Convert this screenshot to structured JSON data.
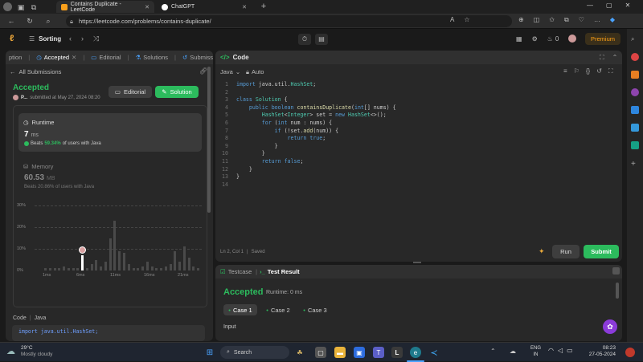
{
  "browser": {
    "tabs": [
      {
        "title": "Contains Duplicate - LeetCode",
        "active": true
      },
      {
        "title": "ChatGPT",
        "active": false
      }
    ],
    "new_tab": "+",
    "url": "https://leetcode.com/problems/contains-duplicate/"
  },
  "lc": {
    "problem_list": "Sorting",
    "premium": "Premium",
    "streak": "0"
  },
  "left": {
    "tabs": [
      "ption",
      "Accepted",
      "Editorial",
      "Solutions",
      "Submissions"
    ],
    "all_submissions": "All Submissions",
    "status": "Accepted",
    "user": "P...",
    "submitted": "submitted at May 27, 2024 08:20",
    "editorial_btn": "Editorial",
    "solution_btn": "Solution",
    "runtime_label": "Runtime",
    "runtime_value": "7",
    "runtime_unit": "ms",
    "beats_prefix": "Beats",
    "runtime_beats": "59.34%",
    "beats_suffix": "of users with Java",
    "memory_label": "Memory",
    "memory_value": "60.53",
    "memory_unit": "MB",
    "memory_beats": "Beats 20.86% of users with Java",
    "y_ticks": [
      "30%",
      "20%",
      "10%",
      "0%"
    ],
    "x_ticks": [
      "1ms",
      "6ms",
      "11ms",
      "16ms",
      "21ms"
    ],
    "mini_ticks": [
      "1ms",
      "6ms",
      "11ms",
      "16ms",
      "21ms"
    ],
    "code_label": "Code",
    "code_lang": "Java",
    "code_preview": "import java.util.HashSet;"
  },
  "editor": {
    "title": "Code",
    "language": "Java",
    "autosave": "Auto",
    "lines": [
      "import java.util.HashSet;",
      "",
      "class Solution {",
      "    public boolean containsDuplicate(int[] nums) {",
      "        HashSet<Integer> set = new HashSet<>();",
      "        for (int num : nums) {",
      "            if (!set.add(num)) {",
      "                return true;",
      "            }",
      "        }",
      "        return false;",
      "    }",
      "}",
      ""
    ],
    "status": "Ln 2, Col 1",
    "saved": "Saved",
    "run": "Run",
    "submit": "Submit"
  },
  "test": {
    "tab_testcase": "Testcase",
    "tab_result": "Test Result",
    "status": "Accepted",
    "runtime": "Runtime: 0 ms",
    "cases": [
      "Case 1",
      "Case 2",
      "Case 3"
    ],
    "input_label": "Input"
  },
  "taskbar": {
    "temp": "29°C",
    "weather": "Mostly cloudy",
    "search": "Search",
    "lang1": "ENG",
    "lang2": "IN",
    "time": "08:23",
    "date": "27-05-2024"
  },
  "chart_data": {
    "type": "bar",
    "ylim": [
      0,
      30
    ],
    "y_ticks": [
      "30%",
      "20%",
      "10%",
      "0%"
    ],
    "x_ticks": [
      "1ms",
      "6ms",
      "11ms",
      "16ms",
      "21ms"
    ],
    "values": [
      1,
      1,
      1,
      1,
      2,
      1,
      1,
      1,
      1,
      1,
      3,
      5,
      2,
      4,
      15,
      23,
      9,
      8,
      3,
      1,
      1,
      2,
      4,
      2,
      1,
      1,
      2,
      3,
      9,
      4,
      11,
      6,
      2,
      1
    ],
    "highlight_index": 8,
    "highlight_value": 7
  }
}
